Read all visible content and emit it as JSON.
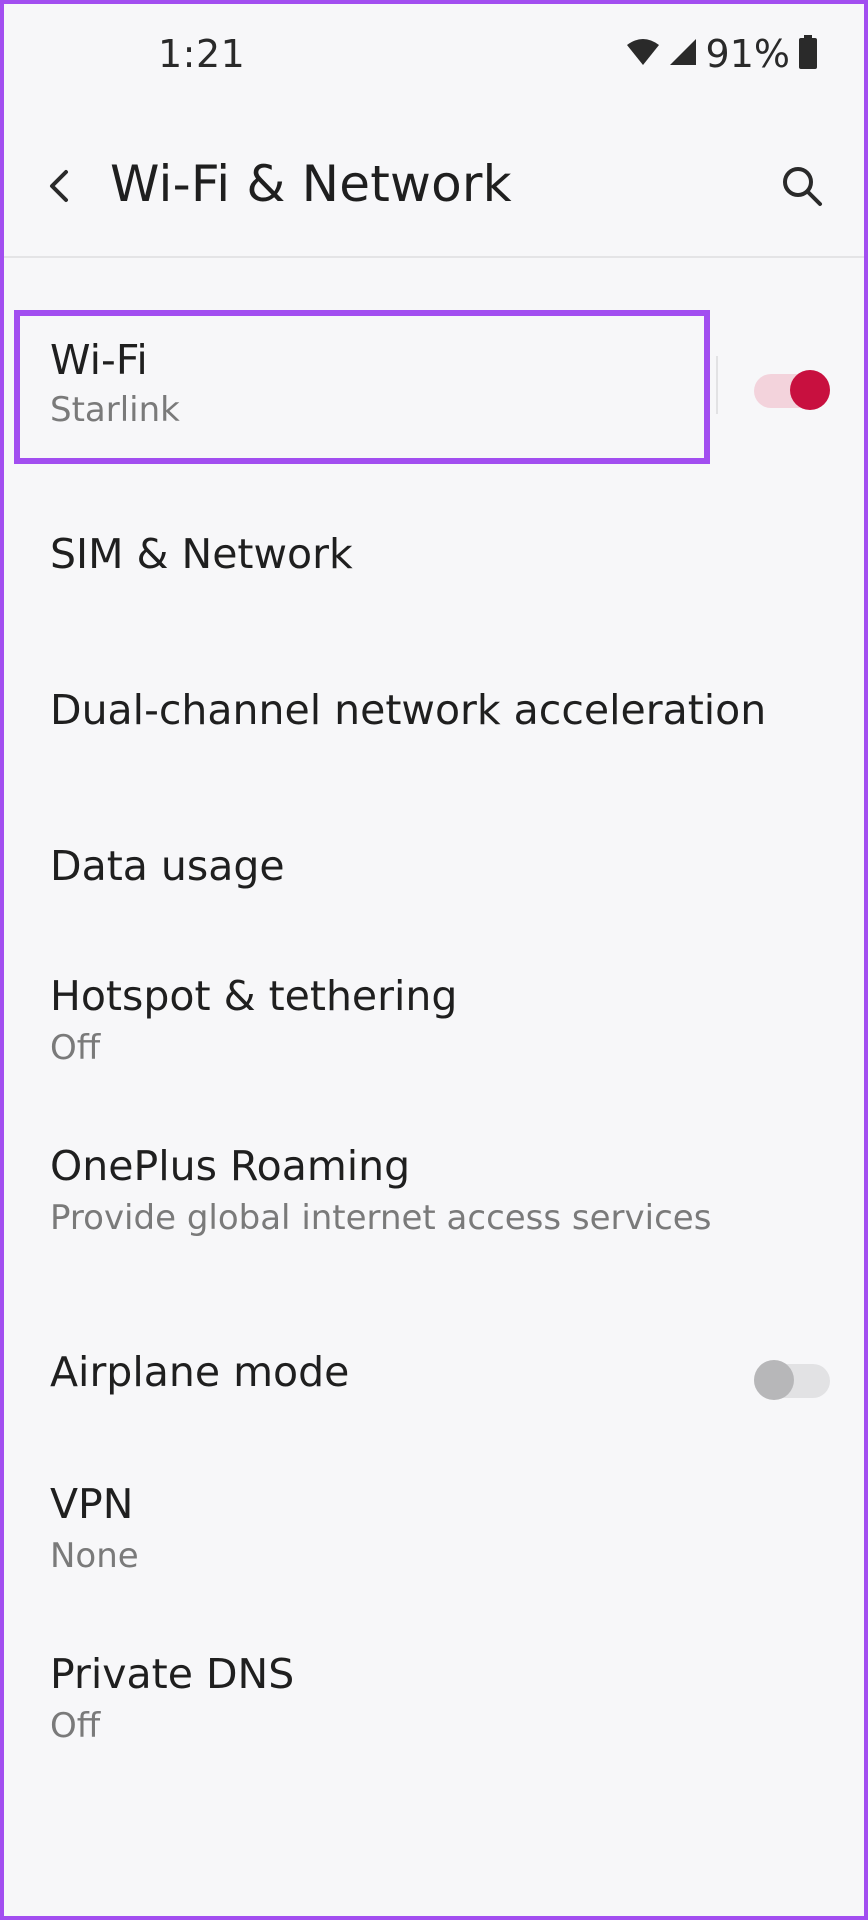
{
  "status_bar": {
    "time": "1:21",
    "battery_percent": "91%",
    "wifi_icon": "wifi-signal-icon",
    "cell_icon": "cellular-signal-icon",
    "battery_icon": "battery-icon"
  },
  "header": {
    "title": "Wi-Fi & Network",
    "back_icon": "chevron-left-icon",
    "search_icon": "search-icon"
  },
  "items": [
    {
      "title": "Wi-Fi",
      "subtitle": "Starlink",
      "toggle": true,
      "toggle_on": true,
      "highlighted": true
    },
    {
      "title": "SIM & Network"
    },
    {
      "title": "Dual-channel network acceleration"
    },
    {
      "title": "Data usage"
    },
    {
      "title": "Hotspot & tethering",
      "subtitle": "Off"
    },
    {
      "title": "OnePlus Roaming",
      "subtitle": "Provide global internet access services"
    },
    {
      "title": "Airplane mode",
      "toggle": true,
      "toggle_on": false
    },
    {
      "title": "VPN",
      "subtitle": "None"
    },
    {
      "title": "Private DNS",
      "subtitle": "Off"
    }
  ],
  "colors": {
    "highlight_border": "#a24ef0",
    "toggle_on_thumb": "#c8103f",
    "toggle_on_track": "#f3d3dc",
    "toggle_off_thumb": "#b7b7b9",
    "toggle_off_track": "#e2e2e4"
  }
}
